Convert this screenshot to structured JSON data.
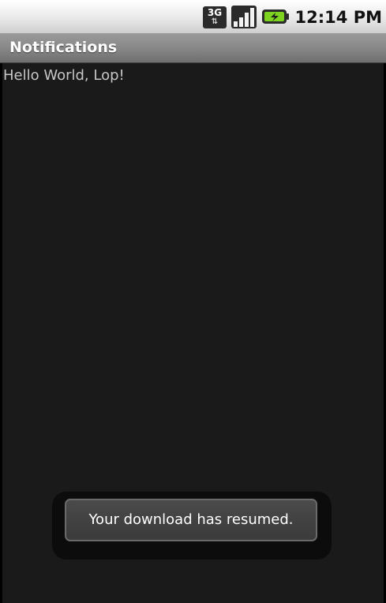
{
  "status_bar": {
    "network_type": "3G",
    "network_icon": "3g-data-icon",
    "signal_icon": "signal-strength-icon",
    "signal_bars": 4,
    "battery_icon": "battery-charging-icon",
    "time": "12:14 PM",
    "colors": {
      "battery_accent": "#7ed321",
      "signal_on": "#4a4a4a",
      "signal_off": "#9a9a9a"
    }
  },
  "app": {
    "title": "Notifications"
  },
  "content": {
    "hello_text": "Hello World, Lop!"
  },
  "toast": {
    "message": "Your download has resumed."
  }
}
